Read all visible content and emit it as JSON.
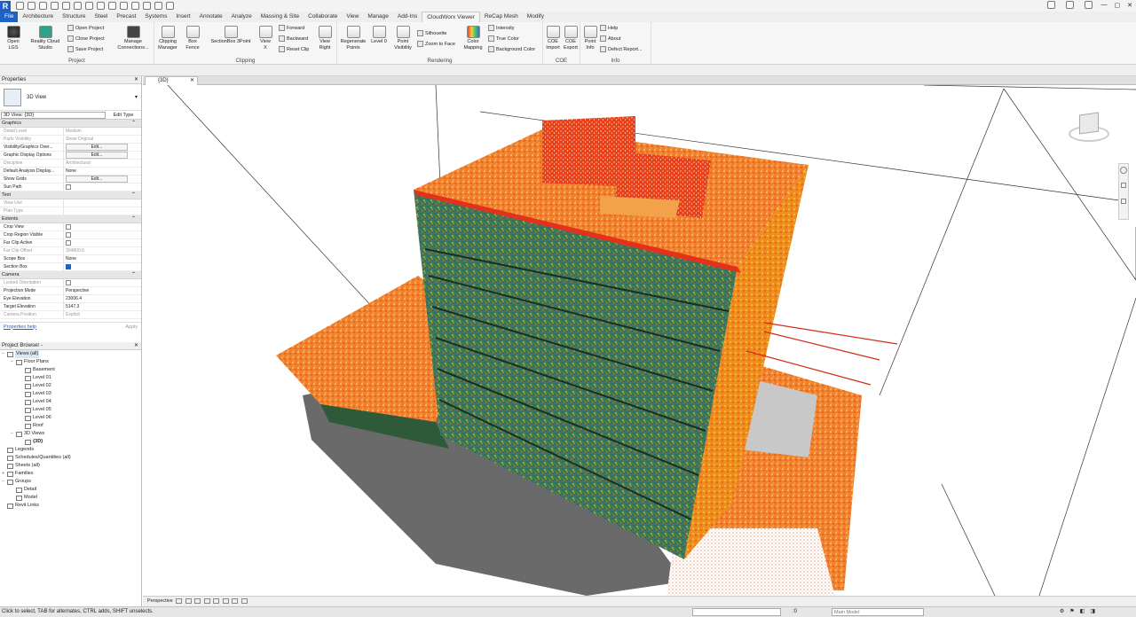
{
  "app": {
    "logo": "R"
  },
  "quick_access": {
    "icon_count": 16
  },
  "ribbon_tabs": [
    "File",
    "Architecture",
    "Structure",
    "Steel",
    "Precast",
    "Systems",
    "Insert",
    "Annotate",
    "Analyze",
    "Massing & Site",
    "Collaborate",
    "View",
    "Manage",
    "Add-Ins",
    "CloudWorx Viewer",
    "ReCap Mesh",
    "Modify"
  ],
  "active_tab": "CloudWorx Viewer",
  "ribbon": {
    "project": {
      "label": "Project",
      "open_lgs": "Open\nLGS",
      "reality": "Reality Cloud\nStudio",
      "open_project": "Open  Project",
      "close_project": "Close  Project",
      "save_project": "Save  Project",
      "manage": "Manage\nConnections..."
    },
    "clipping": {
      "label": "Clipping",
      "manager": "Clipping\nManager",
      "box_fence": "Box\nFence",
      "section3p": "SectionBox 3Point",
      "forward": "Forward",
      "backward": "Backward",
      "reset": "Reset Clip",
      "view_x": "View\nX",
      "view_right": "View\nRight"
    },
    "rendering": {
      "label": "Rendering",
      "regen": "Regenerate\nPoints",
      "level": "Level 0",
      "point_vis": "Point\nVisibility",
      "silhouette": "Silhouette",
      "zoom_face": "Zoom to Face",
      "color_map": "Color\nMapping",
      "intensity": "Intensity",
      "true_color": "True  Color",
      "bg_color": "Background Color"
    },
    "coe": {
      "label": "COE",
      "import": "COE\nImport",
      "export": "COE\nExport"
    },
    "info": {
      "label": "Info",
      "point_info": "Point\nInfo",
      "help": "Help",
      "about": "About",
      "defect": "Defect  Report..."
    }
  },
  "properties": {
    "title": "Properties",
    "type_name": "3D View",
    "selector": "3D View: {3D}",
    "edit_type": "Edit Type",
    "sections": [
      {
        "name": "Graphics",
        "rows": [
          [
            "Detail Level",
            "Medium",
            "dim"
          ],
          [
            "Parts Visibility",
            "Show Original",
            "dim"
          ],
          [
            "Visibility/Graphics Over...",
            "Edit...",
            "btn"
          ],
          [
            "Graphic Display Options",
            "Edit...",
            "btn"
          ],
          [
            "Discipline",
            "Architectural",
            "dim"
          ],
          [
            "Default Analysis Display...",
            "None",
            ""
          ],
          [
            "Show Grids",
            "Edit...",
            "btn"
          ],
          [
            "Sun Path",
            "",
            "chk"
          ]
        ]
      },
      {
        "name": "Text",
        "rows": [
          [
            "View Use",
            "",
            "dim"
          ],
          [
            "Plan Type",
            "",
            "dim"
          ]
        ]
      },
      {
        "name": "Extents",
        "rows": [
          [
            "Crop View",
            "",
            "chk"
          ],
          [
            "Crop Region Visible",
            "",
            "chk"
          ],
          [
            "Far Clip Active",
            "",
            "chk"
          ],
          [
            "Far Clip Offset",
            "304800.0",
            "dim"
          ],
          [
            "Scope Box",
            "None",
            ""
          ],
          [
            "Section Box",
            "",
            "chkon"
          ]
        ]
      },
      {
        "name": "Camera",
        "rows": [
          [
            "Locked Orientation",
            "",
            "dimchk"
          ],
          [
            "Projection Mode",
            "Perspective",
            ""
          ],
          [
            "Eye Elevation",
            "23006.4",
            ""
          ],
          [
            "Target Elevation",
            "5147.3",
            ""
          ],
          [
            "Camera Position",
            "Explicit",
            "dim"
          ]
        ]
      }
    ],
    "help_link": "Properties help",
    "apply": "Apply"
  },
  "browser": {
    "title": "Project Browser - ",
    "items": [
      {
        "d": 0,
        "t": "Views (all)",
        "tog": "−",
        "hl": true
      },
      {
        "d": 1,
        "t": "Floor Plans",
        "tog": "−"
      },
      {
        "d": 2,
        "t": "Basement"
      },
      {
        "d": 2,
        "t": "Level 01"
      },
      {
        "d": 2,
        "t": "Level 02"
      },
      {
        "d": 2,
        "t": "Level 03"
      },
      {
        "d": 2,
        "t": "Level 04"
      },
      {
        "d": 2,
        "t": "Level 05"
      },
      {
        "d": 2,
        "t": "Level 06"
      },
      {
        "d": 2,
        "t": "Roof"
      },
      {
        "d": 1,
        "t": "3D Views",
        "tog": "−"
      },
      {
        "d": 2,
        "t": "{3D}",
        "bold": true
      },
      {
        "d": 0,
        "t": "Legends"
      },
      {
        "d": 0,
        "t": "Schedules/Quantities (all)"
      },
      {
        "d": 0,
        "t": "Sheets (all)"
      },
      {
        "d": 0,
        "t": "Families",
        "tog": "+"
      },
      {
        "d": 0,
        "t": "Groups",
        "tog": "−"
      },
      {
        "d": 1,
        "t": "Detail"
      },
      {
        "d": 1,
        "t": "Model"
      },
      {
        "d": 0,
        "t": "Revit Links"
      }
    ]
  },
  "view_tab": "{3D}",
  "viewcube": {
    "labels": [
      "TOP",
      "FRONT",
      "RIGHT"
    ]
  },
  "view_control_bar": {
    "mode": "Perspective"
  },
  "status": {
    "text": "Click to select, TAB for alternates, CTRL adds, SHIFT unselects.",
    "coords": ":0",
    "model": "Main Model"
  }
}
